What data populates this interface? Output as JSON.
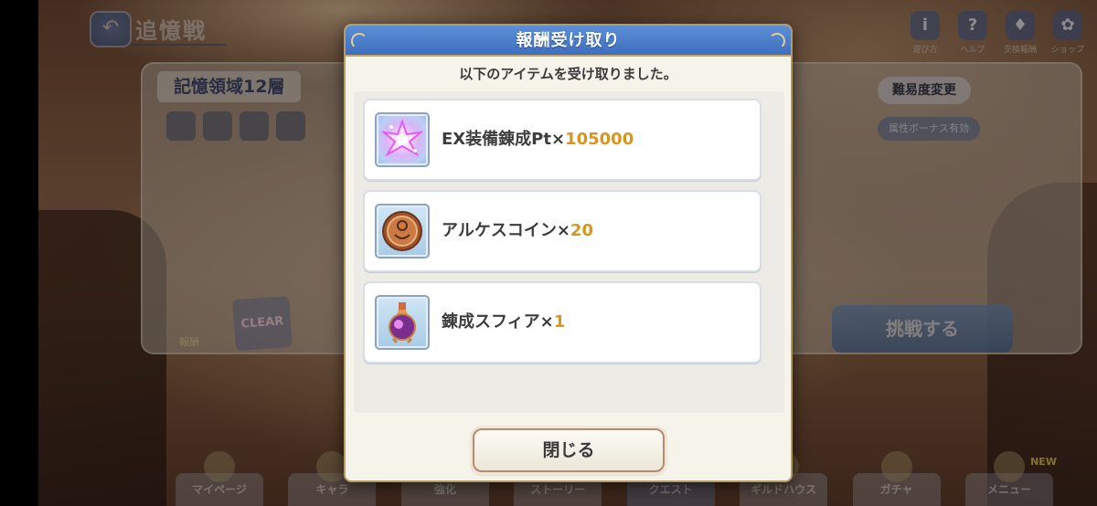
{
  "background": {
    "mode_title": "追憶戦",
    "floor_label": "記憶領域12層",
    "difficulty_button": "難易度変更",
    "bonus_label": "属性ボーナス有効",
    "challenge_button": "挑戦する",
    "clear_badge": "CLEAR",
    "reward_label": "報酬",
    "top_icons": [
      {
        "icon": "info-icon",
        "glyph": "i",
        "label": "遊び方"
      },
      {
        "icon": "help-icon",
        "glyph": "?",
        "label": "ヘルプ"
      },
      {
        "icon": "shop-character-icon",
        "glyph": "♦",
        "label": "交換報酬"
      },
      {
        "icon": "shop-icon",
        "glyph": "✿",
        "label": "ショップ"
      }
    ],
    "nav": [
      {
        "label": "マイページ"
      },
      {
        "label": "キャラ"
      },
      {
        "label": "強化"
      },
      {
        "label": "ストーリー"
      },
      {
        "label": "クエスト"
      },
      {
        "label": "ギルドハウス"
      },
      {
        "label": "ガチャ"
      },
      {
        "label": "メニュー",
        "badge": "NEW"
      }
    ]
  },
  "modal": {
    "title": "報酬受け取り",
    "message": "以下のアイテムを受け取りました。",
    "items": [
      {
        "icon": "ex-equipment-crystal-icon",
        "name": "EX装備錬成Pt",
        "times": "×",
        "qty": "105000"
      },
      {
        "icon": "arkes-coin-icon",
        "name": "アルケスコイン",
        "times": "×",
        "qty": "20"
      },
      {
        "icon": "alchemy-sphere-flask-icon",
        "name": "錬成スフィア",
        "times": "×",
        "qty": "1"
      }
    ],
    "close_label": "閉じる"
  },
  "colors": {
    "header_blue": "#4a7dc9",
    "quantity_gold": "#d8961a",
    "frame_gold": "#b79b66"
  }
}
